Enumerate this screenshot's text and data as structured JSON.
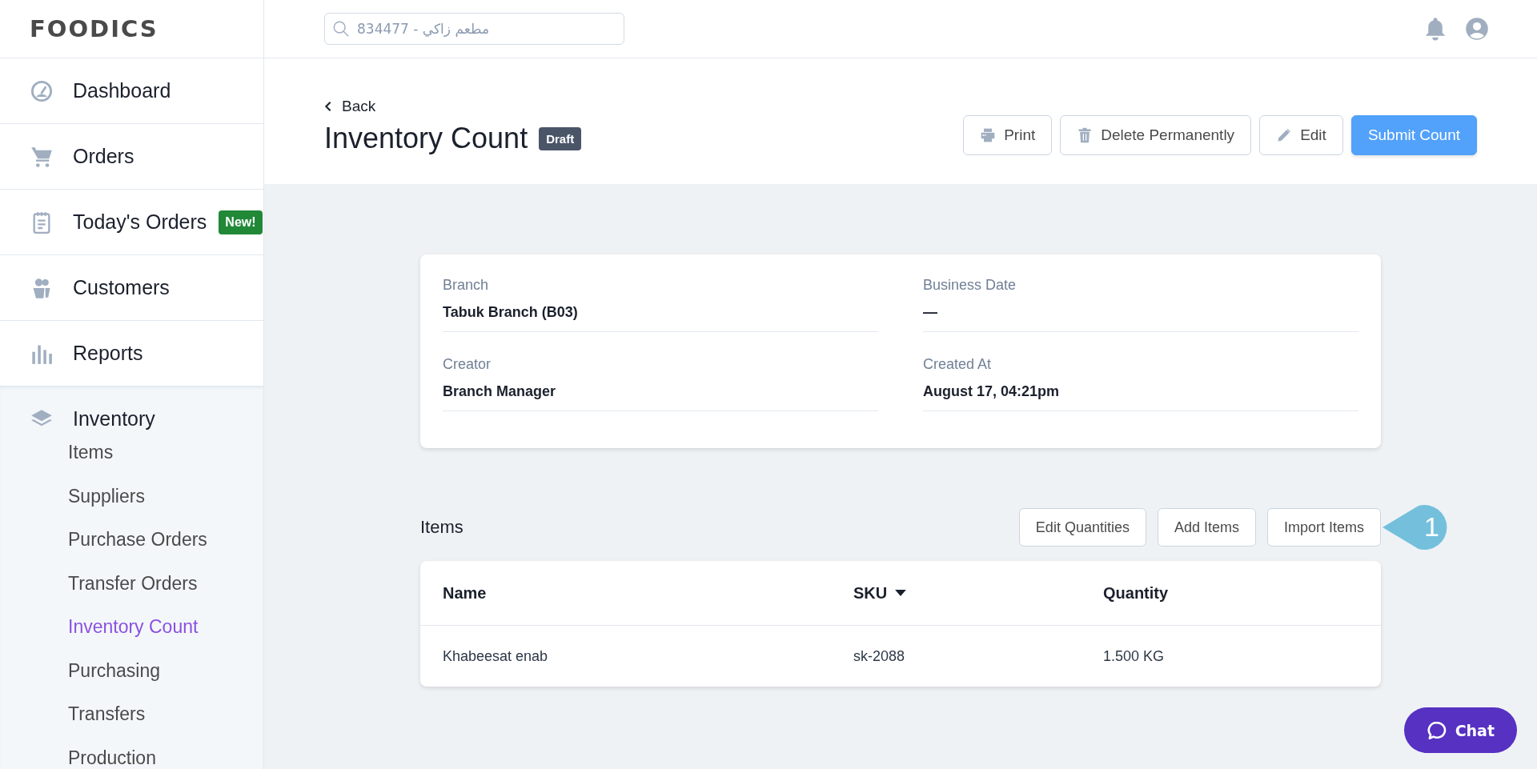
{
  "logo": "FOODICS",
  "search": {
    "placeholder": "834477 - مطعم زاكي"
  },
  "sidebar": {
    "items": [
      {
        "label": "Dashboard",
        "selected": false,
        "expanded": false
      },
      {
        "label": "Orders",
        "selected": false,
        "expanded": false
      },
      {
        "label": "Today's Orders",
        "badge": "New!",
        "selected": false,
        "expanded": false
      },
      {
        "label": "Customers",
        "selected": false,
        "expanded": false
      },
      {
        "label": "Reports",
        "selected": false,
        "expanded": false
      },
      {
        "label": "Inventory",
        "selected": false,
        "expanded": true,
        "children": [
          {
            "label": "Items",
            "selected": false
          },
          {
            "label": "Suppliers",
            "selected": false
          },
          {
            "label": "Purchase Orders",
            "selected": false
          },
          {
            "label": "Transfer Orders",
            "selected": false
          },
          {
            "label": "Inventory Count",
            "selected": true
          },
          {
            "label": "Purchasing",
            "selected": false
          },
          {
            "label": "Transfers",
            "selected": false
          },
          {
            "label": "Production",
            "selected": false
          }
        ]
      }
    ]
  },
  "page": {
    "back": "Back",
    "title": "Inventory Count",
    "status": "Draft",
    "actions": [
      {
        "label": "Print",
        "kind": "outline"
      },
      {
        "label": "Delete Permanently",
        "kind": "outline"
      },
      {
        "label": "Edit",
        "kind": "outline"
      },
      {
        "label": "Submit Count",
        "kind": "primary"
      }
    ]
  },
  "details": {
    "fields": [
      {
        "label": "Branch",
        "value": "Tabuk Branch (B03)"
      },
      {
        "label": "Business Date",
        "value": "—"
      },
      {
        "label": "Creator",
        "value": "Branch Manager"
      },
      {
        "label": "Created At",
        "value": "August 17, 04:21pm"
      }
    ]
  },
  "items": {
    "heading": "Items",
    "buttons": [
      "Edit Quantities",
      "Add Items",
      "Import Items"
    ],
    "callout": "1",
    "table": {
      "columns": [
        {
          "label": "Name",
          "sorted": false
        },
        {
          "label": "SKU",
          "sorted": true
        },
        {
          "label": "Quantity",
          "sorted": false
        }
      ],
      "rows": [
        [
          "Khabeesat enab",
          "sk-2088",
          "1.500 KG"
        ]
      ]
    }
  },
  "chat": {
    "label": "Chat"
  }
}
